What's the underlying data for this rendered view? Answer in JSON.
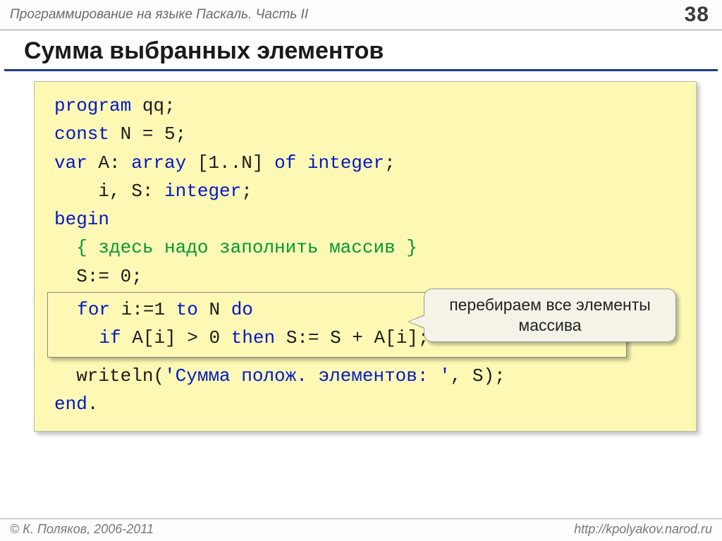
{
  "header": {
    "title": "Программирование на языке Паскаль. Часть II",
    "page_number": "38"
  },
  "slide": {
    "title": "Сумма выбранных элементов"
  },
  "code": {
    "l1_kw": "program",
    "l1_rest": " qq;",
    "l2_kw": "const",
    "l2_rest": " N = 5;",
    "l3_kw": "var",
    "l3_rest": " A: ",
    "l3_kw2": "array",
    "l3_rest2": " [1..N] ",
    "l3_kw3": "of integer",
    "l3_rest3": ";",
    "l4": "    i, S: ",
    "l4_kw": "integer",
    "l4_rest": ";",
    "l5_kw": "begin",
    "l6_comment": "  { здесь надо заполнить массив }",
    "l7": "  S:= 0;",
    "l8_pre": "  ",
    "l8_kw": "for",
    "l8_mid": " i:=1 ",
    "l8_kw2": "to",
    "l8_mid2": " N ",
    "l8_kw3": "do",
    "l9_pre": "    ",
    "l9_kw": "if",
    "l9_mid": " A[i] > 0 ",
    "l9_kw2": "then",
    "l9_rest": " S:= S + A[i];",
    "l10_pre": "  writeln(",
    "l10_str": "'Сумма полож. элементов: '",
    "l10_rest": ", S);",
    "l11_kw": "end",
    "l11_rest": "."
  },
  "callout": {
    "text": "перебираем все элементы массива"
  },
  "footer": {
    "copyright": "© К. Поляков, 2006-2011",
    "url": "http://kpolyakov.narod.ru"
  }
}
